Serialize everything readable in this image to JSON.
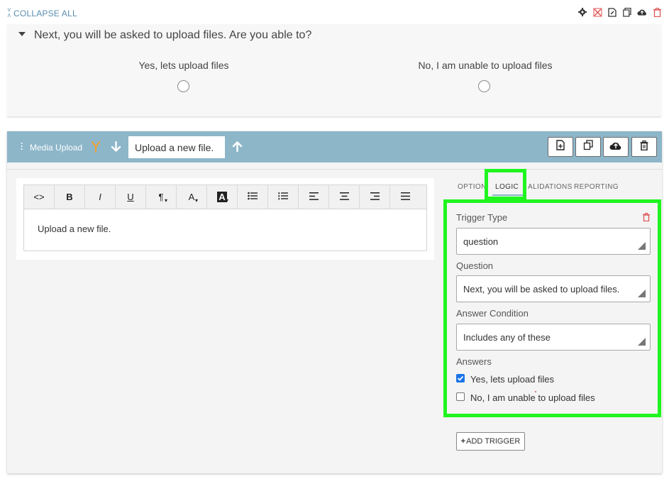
{
  "top_bar": {
    "collapse_all_label": "COLLAPSE ALL",
    "icons": [
      "gear-icon",
      "cancel-x-icon",
      "document-edit-icon",
      "copy-icon",
      "cloud-upload-icon",
      "trash-icon"
    ]
  },
  "question_card": {
    "title": "Next, you will be asked to upload files.  Are you able to?",
    "options": [
      {
        "label": "Yes, lets upload files"
      },
      {
        "label": "No, I am unable to upload files"
      }
    ]
  },
  "media_upload": {
    "header_label": "Media Upload",
    "title_value": "Upload a new file.",
    "editor": {
      "toolbar": [
        "<>",
        "B",
        "I",
        "U",
        "¶",
        "A",
        "A",
        "bulleted-list",
        "numbered-list",
        "align-left",
        "align-center",
        "align-right",
        "align-justify"
      ],
      "body_text": "Upload a new file."
    },
    "tabs": [
      {
        "label": "OPTION"
      },
      {
        "label": "LOGIC"
      },
      {
        "label": "ALIDATIONS"
      },
      {
        "label": "REPORTING"
      }
    ],
    "active_tab": "LOGIC",
    "logic": {
      "trigger_type_label": "Trigger Type",
      "trigger_type_value": "question",
      "question_label": "Question",
      "question_value": "Next, you will be asked to upload files.",
      "answer_condition_label": "Answer Condition",
      "answer_condition_value": "Includes any of these",
      "answers_label": "Answers",
      "answers": [
        {
          "label": "Yes, lets upload files",
          "checked": true
        },
        {
          "label": "No, I am unable to upload files",
          "checked": false
        }
      ],
      "add_trigger_label": "ADD TRIGGER"
    }
  },
  "colors": {
    "header_bg": "#8db6c9",
    "highlight": "#1ff51f",
    "delete_red": "#e05555",
    "link_blue": "#5a8fb0",
    "branch_orange": "#f0a030"
  }
}
